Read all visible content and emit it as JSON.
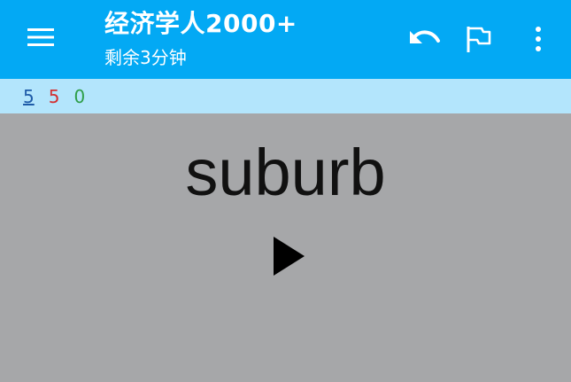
{
  "app_bar": {
    "title": "经济学人2000+",
    "subtitle": "剩余3分钟",
    "background": "#03a9f4",
    "icons": {
      "menu": "menu-icon",
      "undo": "undo-icon",
      "flag": "flag-icon",
      "more": "more-vert-icon"
    }
  },
  "stats": {
    "first": "5",
    "second": "5",
    "third": "0",
    "colors": {
      "first": "#1e5ba8",
      "second": "#d32f2f",
      "third": "#2e9e48"
    }
  },
  "card": {
    "word": "suburb",
    "play_icon": "play-icon"
  }
}
